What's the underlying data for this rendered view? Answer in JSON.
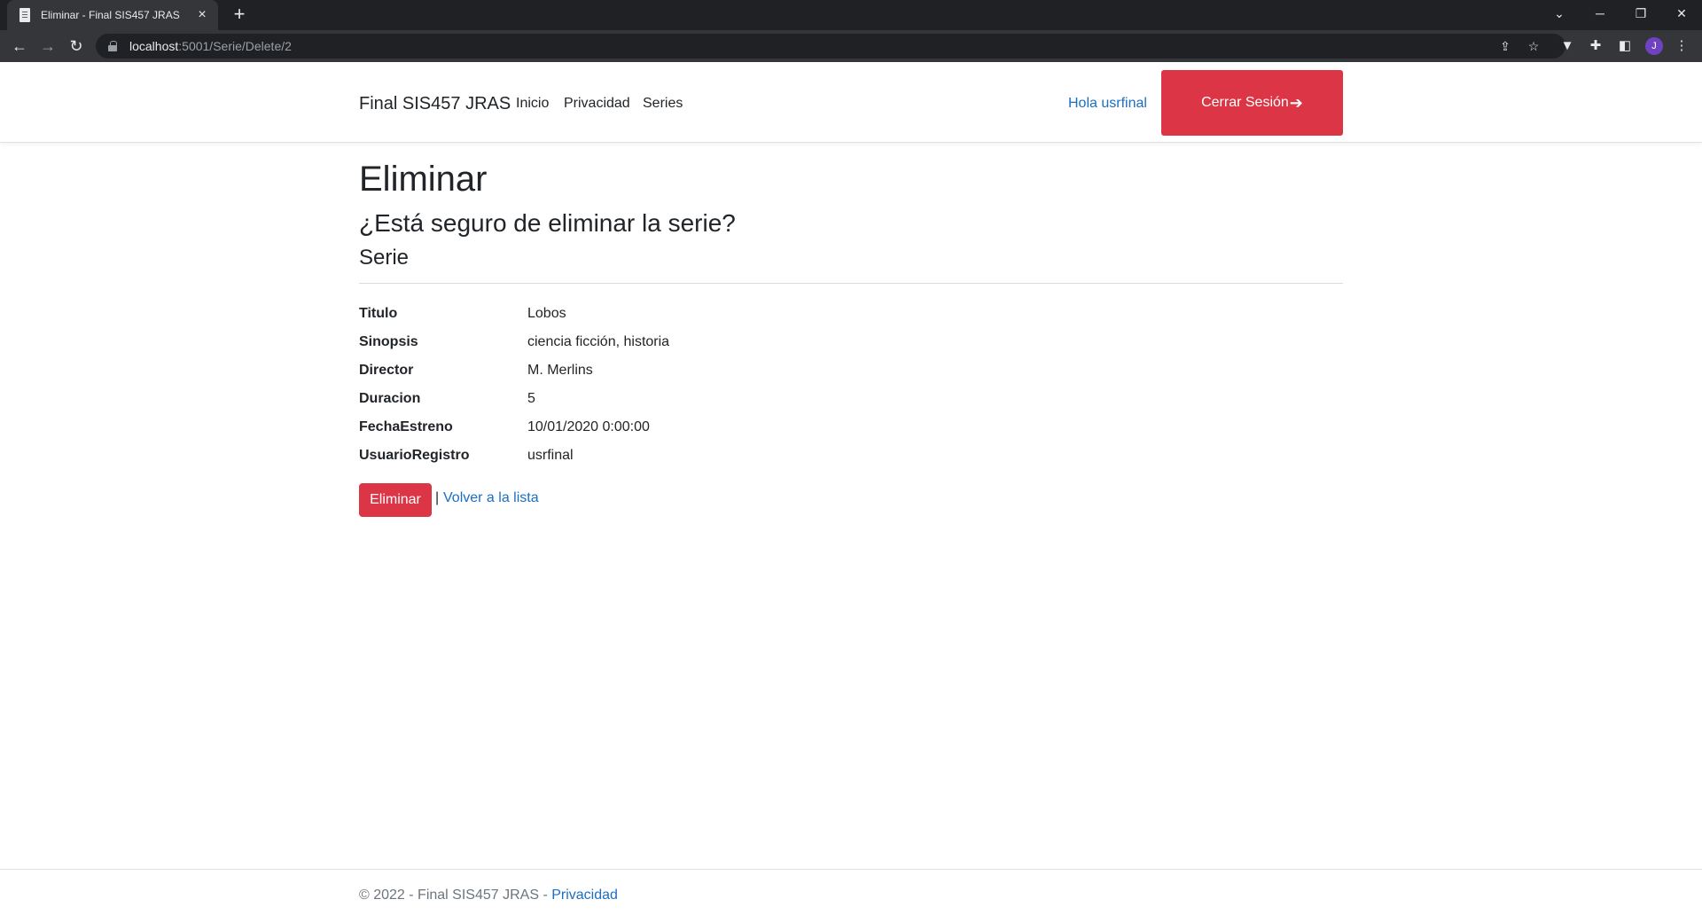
{
  "browser": {
    "tab_title": "Eliminar - Final SIS457 JRAS",
    "new_tab_symbol": "+",
    "url_host": "localhost",
    "url_path": ":5001/Serie/Delete/2",
    "profile_initial": "J"
  },
  "navbar": {
    "brand": "Final SIS457 JRAS",
    "links": [
      "Inicio",
      "Privacidad",
      "Series"
    ],
    "greeting": "Hola usrfinal",
    "logout_label": "Cerrar Sesión"
  },
  "main": {
    "title": "Eliminar",
    "question": "¿Está seguro de eliminar la serie?",
    "entity": "Serie",
    "fields": [
      {
        "label": "Titulo",
        "value": "Lobos"
      },
      {
        "label": "Sinopsis",
        "value": "ciencia ficción, historia"
      },
      {
        "label": "Director",
        "value": "M. Merlins"
      },
      {
        "label": "Duracion",
        "value": "5"
      },
      {
        "label": "FechaEstreno",
        "value": "10/01/2020 0:00:00"
      },
      {
        "label": "UsuarioRegistro",
        "value": "usrfinal"
      }
    ],
    "delete_label": "Eliminar",
    "separator": "|",
    "back_label": "Volver a la lista"
  },
  "footer": {
    "text": "© 2022 - Final SIS457 JRAS - ",
    "link": "Privacidad"
  },
  "colors": {
    "danger": "#dc3545",
    "link": "#1b6ec2",
    "chrome_dark": "#202124"
  }
}
